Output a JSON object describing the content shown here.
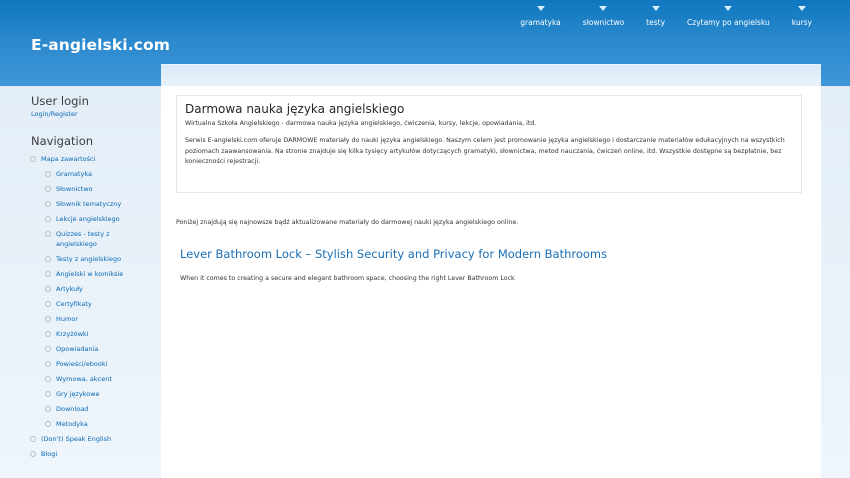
{
  "site": {
    "name": "E-angielski.com"
  },
  "topnav": [
    {
      "label": "gramatyka"
    },
    {
      "label": "słownictwo"
    },
    {
      "label": "testy"
    },
    {
      "label": "Czytamy po angielsku"
    },
    {
      "label": "kursy"
    }
  ],
  "sidebar": {
    "user_login": {
      "title": "User login",
      "link": "Login/Register"
    },
    "navigation": {
      "title": "Navigation",
      "items": [
        {
          "label": "Mapa zawartości",
          "level": "top"
        },
        {
          "label": "Gramatyka",
          "level": "sub"
        },
        {
          "label": "Słownictwo",
          "level": "sub"
        },
        {
          "label": "Słownik tematyczny",
          "level": "sub"
        },
        {
          "label": "Lekcje angielskiego",
          "level": "sub"
        },
        {
          "label": "Quizzes - testy z angielskiego",
          "level": "sub"
        },
        {
          "label": "Testy z angielskiego",
          "level": "sub"
        },
        {
          "label": "Angielski w komiksie",
          "level": "sub"
        },
        {
          "label": "Artykuły",
          "level": "sub"
        },
        {
          "label": "Certyfikaty",
          "level": "sub"
        },
        {
          "label": "Humor",
          "level": "sub"
        },
        {
          "label": "Krzyżówki",
          "level": "sub"
        },
        {
          "label": "Opowiadania",
          "level": "sub"
        },
        {
          "label": "Powieści/ebooki",
          "level": "sub"
        },
        {
          "label": "Wymowa, akcent",
          "level": "sub"
        },
        {
          "label": "Gry językowe",
          "level": "sub"
        },
        {
          "label": "Download",
          "level": "sub"
        },
        {
          "label": "Metodyka",
          "level": "sub"
        },
        {
          "label": "(Don't) Speak English",
          "level": "top"
        },
        {
          "label": "Blogi",
          "level": "top"
        }
      ]
    }
  },
  "intro": {
    "title": "Darmowa nauka języka angielskiego",
    "subtitle": "Wirtualna Szkoła Angielskiego - darmowa nauka języka angielskiego, ćwiczenia, kursy, lekcje, opowiadania, itd.",
    "body": "Serwis E-angielski.com oferuje DARMOWE materiały do nauki języka angielskiego. Naszym celem jest promowanie języka angielskiego i dostarczanie materiałów edukacyjnych na wszystkich poziomach zaawansowania. Na stronie znajduje się kilka tysięcy artykułów dotyczących gramatyki, słownictwa, metod nauczania, ćwiczeń online, itd. Wszystkie dostępne są bezpłatnie, bez konieczności rejestracji."
  },
  "recent_note": "Poniżej znajdują się najnowsze bądź aktualizowane materiały do darmowej nauki języka angielskiego online.",
  "article": {
    "title": "Lever Bathroom Lock – Stylish Security and Privacy for Modern Bathrooms",
    "teaser": "When it comes to creating a secure and elegant bathroom space, choosing the right Lever Bathroom Lock"
  }
}
